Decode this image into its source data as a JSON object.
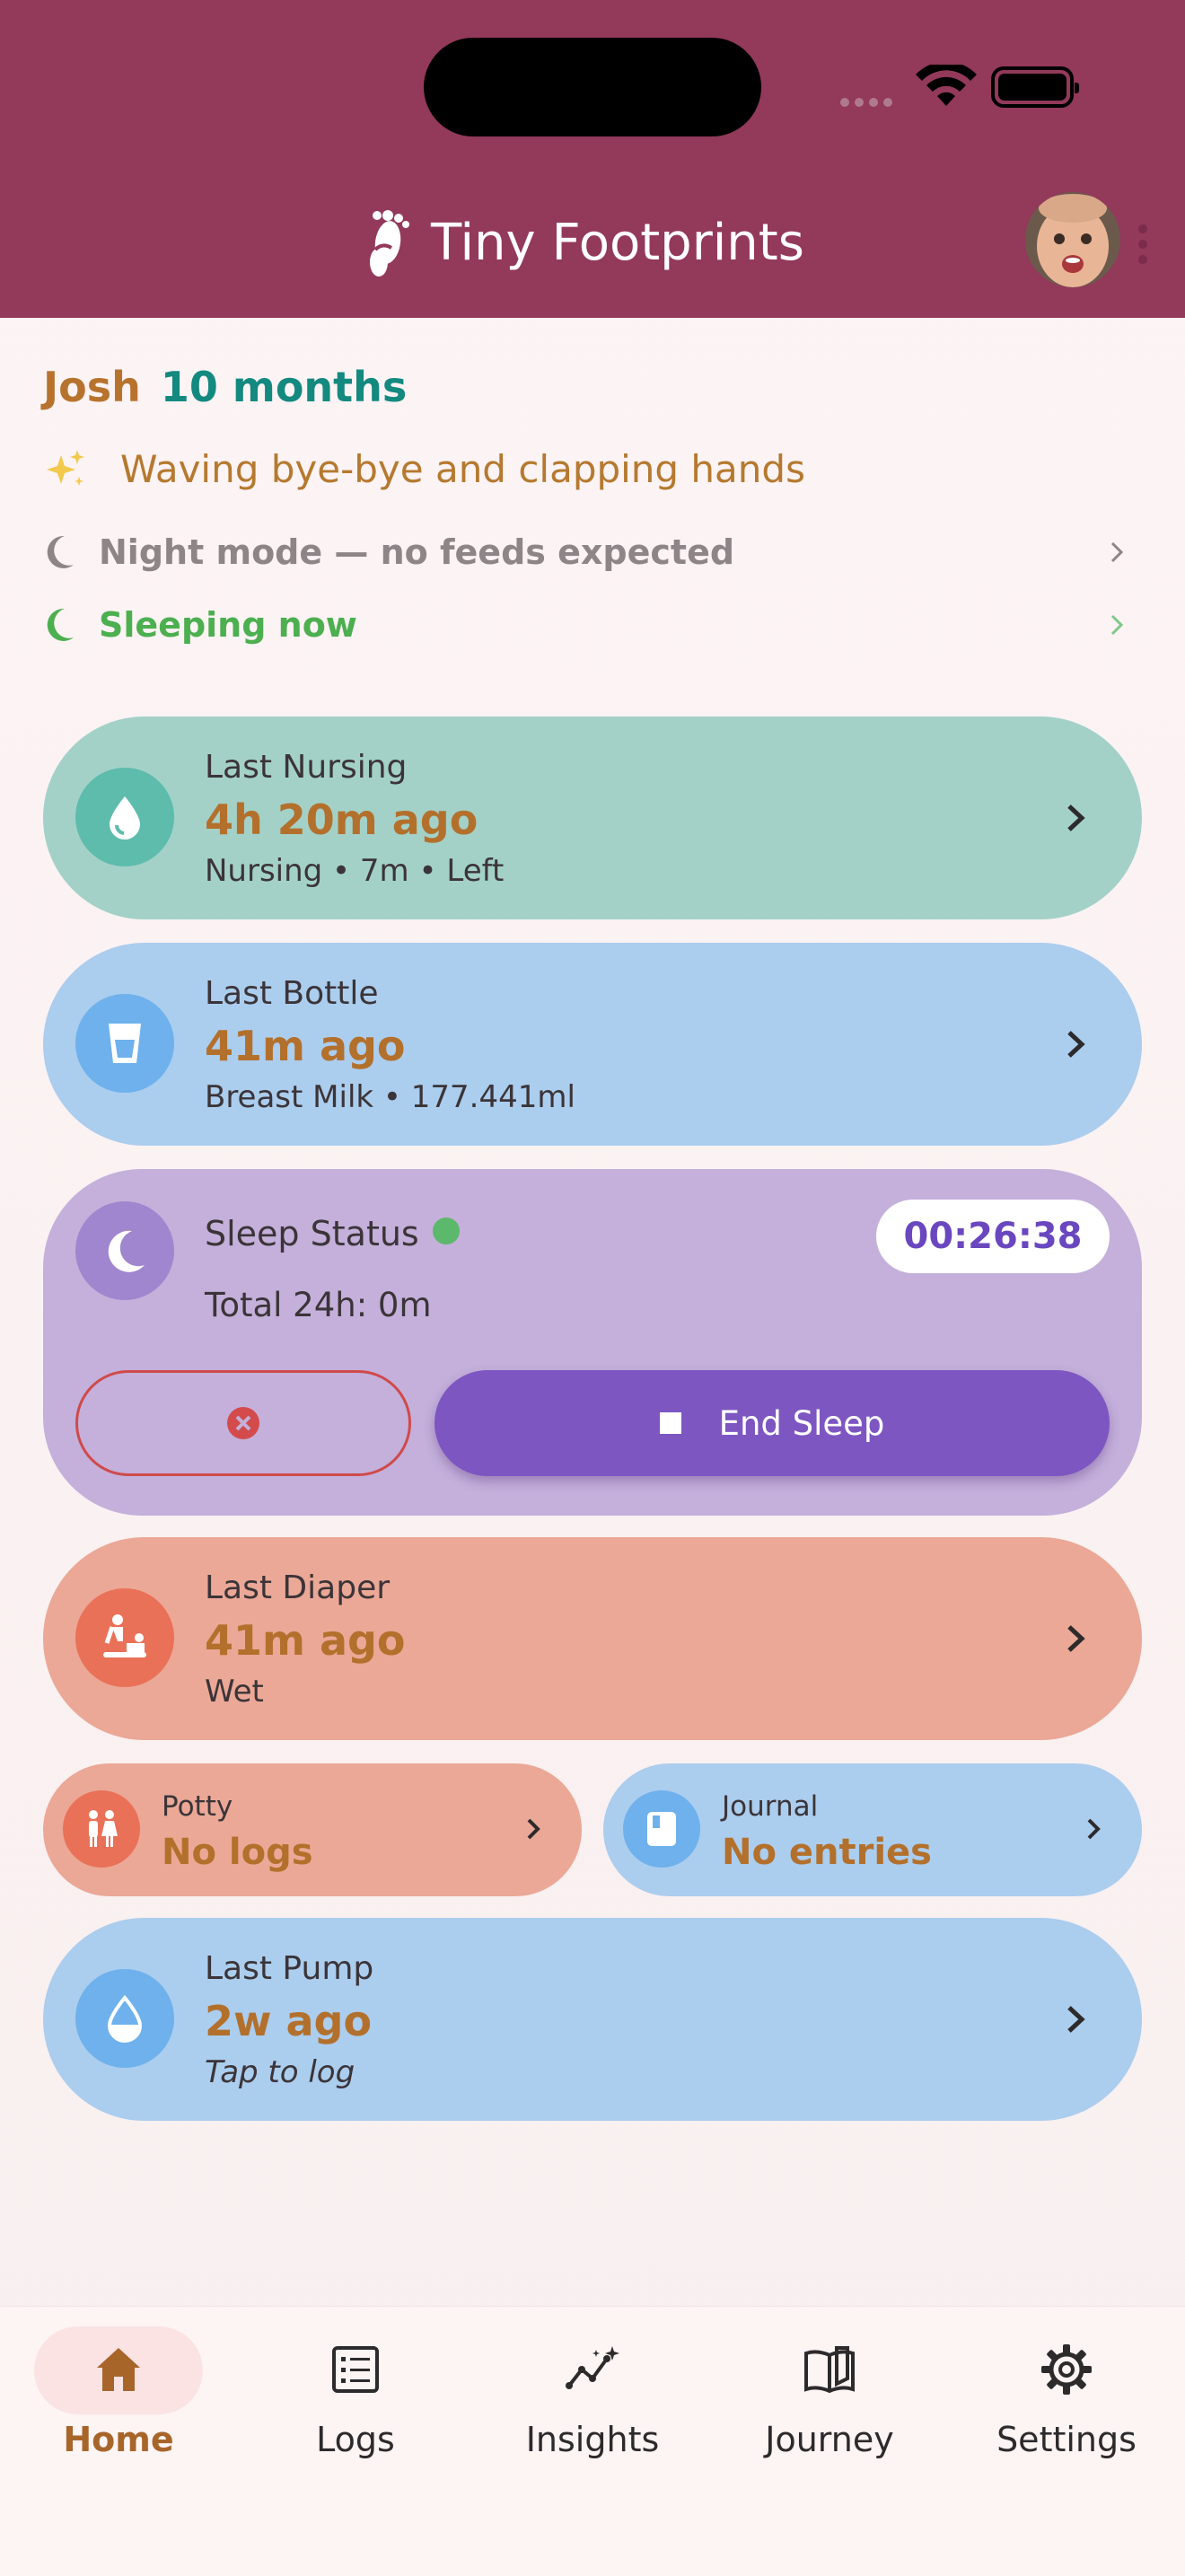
{
  "app": {
    "title": "Tiny Footprints"
  },
  "child": {
    "name": "Josh",
    "age": "10 months"
  },
  "milestone": "Waving bye-bye and clapping hands",
  "night_mode": {
    "label": "Night mode — no feeds expected",
    "color": "#8d8587"
  },
  "sleeping_now": {
    "label": "Sleeping now",
    "color": "#4caf50"
  },
  "cards": {
    "nursing": {
      "title": "Last Nursing",
      "value": "4h 20m ago",
      "detail": "Nursing • 7m • Left",
      "bg": "#a3d1c8",
      "icon_bg": "#5dbcac",
      "icon": "drop-icon"
    },
    "bottle": {
      "title": "Last Bottle",
      "value": "41m ago",
      "detail": "Breast Milk • 177.441ml",
      "bg": "#abcdee",
      "icon_bg": "#6eb1ec",
      "icon": "cup-icon"
    },
    "diaper": {
      "title": "Last Diaper",
      "value": "41m ago",
      "detail": "Wet",
      "bg": "#eba896",
      "icon_bg": "#e97158",
      "icon": "baby-changing-icon"
    },
    "pump": {
      "title": "Last Pump",
      "value": "2w ago",
      "detail": "Tap to log",
      "bg": "#abcdee",
      "icon_bg": "#6eb1ec",
      "icon": "half-drop-icon"
    }
  },
  "sleep": {
    "title": "Sleep Status",
    "total": "Total 24h: 0m",
    "timer": "00:26:38",
    "end_label": "End Sleep",
    "bg": "#c4b0db",
    "accent": "#7d56c2"
  },
  "potty": {
    "title": "Potty",
    "value": "No logs"
  },
  "journal": {
    "title": "Journal",
    "value": "No entries"
  },
  "nav": {
    "items": [
      {
        "label": "Home",
        "icon": "home-icon",
        "active": true
      },
      {
        "label": "Logs",
        "icon": "list-icon",
        "active": false
      },
      {
        "label": "Insights",
        "icon": "insights-icon",
        "active": false
      },
      {
        "label": "Journey",
        "icon": "book-icon",
        "active": false
      },
      {
        "label": "Settings",
        "icon": "gear-icon",
        "active": false
      }
    ],
    "active_color": "#a8652a"
  },
  "colors": {
    "header": "#93395a",
    "accent_value": "#b3702c"
  }
}
